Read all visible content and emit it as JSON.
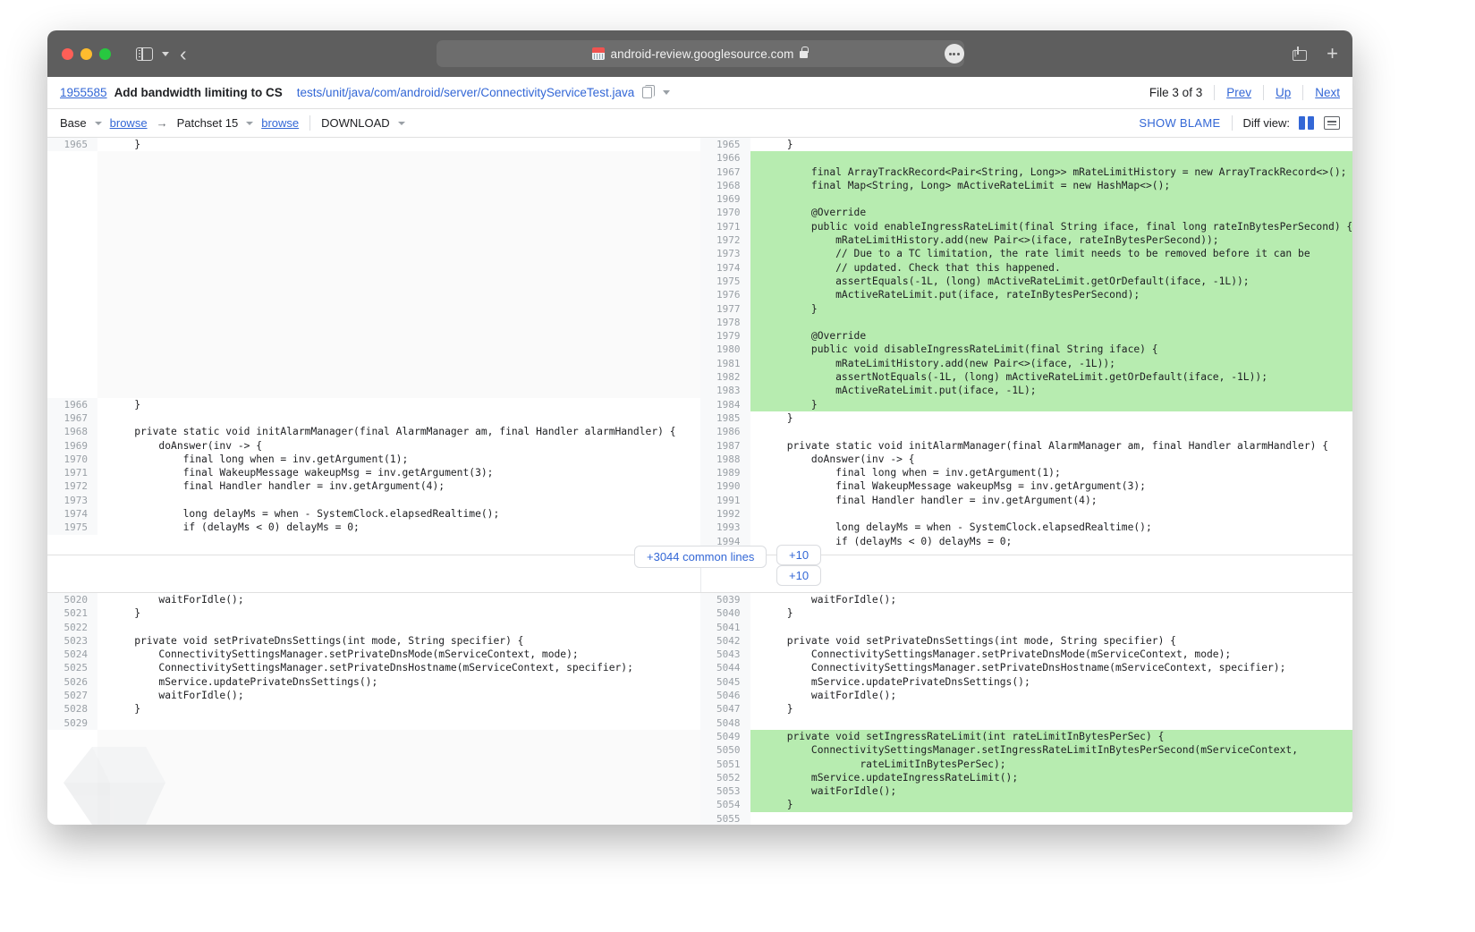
{
  "browser": {
    "url": "android-review.googlesource.com",
    "favicon_name": "gerrit-favicon",
    "lock_name": "lock-icon",
    "sidebar_toggle_name": "sidebar-toggle-icon",
    "back_name": "back-button",
    "share_name": "share-icon",
    "new_tab_name": "new-tab-button",
    "page_menu_name": "page-menu-button"
  },
  "header": {
    "change_number": "1955585",
    "subject": "Add bandwidth limiting to CS",
    "file_path": "tests/unit/java/com/android/server/ConnectivityServiceTest.java",
    "file_count": "File 3 of 3",
    "prev": "Prev",
    "up": "Up",
    "next": "Next"
  },
  "subheader": {
    "base": "Base",
    "browse_left": "browse",
    "arrow": "→",
    "patchset": "Patchset 15",
    "browse_right": "browse",
    "download": "DOWNLOAD",
    "show_blame": "SHOW BLAME",
    "diff_view_label": "Diff view:",
    "diff_view_side_by_side": "side-by-side",
    "diff_view_unified": "unified"
  },
  "widgets": {
    "common_lines": "+3044 common lines",
    "expand_up": "+10",
    "expand_down": "+10"
  },
  "colors": {
    "added_bg": "#b7ecb0",
    "link": "#3367d6",
    "line_number": "#9aa0a6",
    "chrome": "#5e5e5e"
  },
  "diff": {
    "top": {
      "left": [
        {
          "n": "1965",
          "t": "    }",
          "add": false,
          "partial": true
        },
        {
          "n": "",
          "t": "",
          "add": false,
          "fill": true
        },
        {
          "n": "",
          "t": "",
          "add": false,
          "fill": true
        },
        {
          "n": "",
          "t": "",
          "add": false,
          "fill": true
        },
        {
          "n": "",
          "t": "",
          "add": false,
          "fill": true
        },
        {
          "n": "",
          "t": "",
          "add": false,
          "fill": true
        },
        {
          "n": "",
          "t": "",
          "add": false,
          "fill": true
        },
        {
          "n": "",
          "t": "",
          "add": false,
          "fill": true
        },
        {
          "n": "",
          "t": "",
          "add": false,
          "fill": true
        },
        {
          "n": "",
          "t": "",
          "add": false,
          "fill": true
        },
        {
          "n": "",
          "t": "",
          "add": false,
          "fill": true
        },
        {
          "n": "",
          "t": "",
          "add": false,
          "fill": true
        },
        {
          "n": "",
          "t": "",
          "add": false,
          "fill": true
        },
        {
          "n": "",
          "t": "",
          "add": false,
          "fill": true
        },
        {
          "n": "",
          "t": "",
          "add": false,
          "fill": true
        },
        {
          "n": "",
          "t": "",
          "add": false,
          "fill": true
        },
        {
          "n": "",
          "t": "",
          "add": false,
          "fill": true
        },
        {
          "n": "",
          "t": "",
          "add": false,
          "fill": true
        },
        {
          "n": "",
          "t": "",
          "add": false,
          "fill": true
        },
        {
          "n": "1966",
          "t": "    }",
          "add": false
        },
        {
          "n": "1967",
          "t": "",
          "add": false
        },
        {
          "n": "1968",
          "t": "    private static void initAlarmManager(final AlarmManager am, final Handler alarmHandler) {",
          "add": false
        },
        {
          "n": "1969",
          "t": "        doAnswer(inv -> {",
          "add": false
        },
        {
          "n": "1970",
          "t": "            final long when = inv.getArgument(1);",
          "add": false
        },
        {
          "n": "1971",
          "t": "            final WakeupMessage wakeupMsg = inv.getArgument(3);",
          "add": false
        },
        {
          "n": "1972",
          "t": "            final Handler handler = inv.getArgument(4);",
          "add": false
        },
        {
          "n": "1973",
          "t": "",
          "add": false
        },
        {
          "n": "1974",
          "t": "            long delayMs = when - SystemClock.elapsedRealtime();",
          "add": false
        },
        {
          "n": "1975",
          "t": "            if (delayMs < 0) delayMs = 0;",
          "add": false
        }
      ],
      "right": [
        {
          "n": "1965",
          "t": "    }",
          "add": false,
          "partial": true
        },
        {
          "n": "1966",
          "t": "",
          "add": true
        },
        {
          "n": "1967",
          "t": "        final ArrayTrackRecord<Pair<String, Long>> mRateLimitHistory = new ArrayTrackRecord<>();",
          "add": true
        },
        {
          "n": "1968",
          "t": "        final Map<String, Long> mActiveRateLimit = new HashMap<>();",
          "add": true
        },
        {
          "n": "1969",
          "t": "",
          "add": true
        },
        {
          "n": "1970",
          "t": "        @Override",
          "add": true
        },
        {
          "n": "1971",
          "t": "        public void enableIngressRateLimit(final String iface, final long rateInBytesPerSecond) {",
          "add": true
        },
        {
          "n": "1972",
          "t": "            mRateLimitHistory.add(new Pair<>(iface, rateInBytesPerSecond));",
          "add": true
        },
        {
          "n": "1973",
          "t": "            // Due to a TC limitation, the rate limit needs to be removed before it can be",
          "add": true
        },
        {
          "n": "1974",
          "t": "            // updated. Check that this happened.",
          "add": true
        },
        {
          "n": "1975",
          "t": "            assertEquals(-1L, (long) mActiveRateLimit.getOrDefault(iface, -1L));",
          "add": true
        },
        {
          "n": "1976",
          "t": "            mActiveRateLimit.put(iface, rateInBytesPerSecond);",
          "add": true
        },
        {
          "n": "1977",
          "t": "        }",
          "add": true
        },
        {
          "n": "1978",
          "t": "",
          "add": true
        },
        {
          "n": "1979",
          "t": "        @Override",
          "add": true
        },
        {
          "n": "1980",
          "t": "        public void disableIngressRateLimit(final String iface) {",
          "add": true
        },
        {
          "n": "1981",
          "t": "            mRateLimitHistory.add(new Pair<>(iface, -1L));",
          "add": true
        },
        {
          "n": "1982",
          "t": "            assertNotEquals(-1L, (long) mActiveRateLimit.getOrDefault(iface, -1L));",
          "add": true
        },
        {
          "n": "1983",
          "t": "            mActiveRateLimit.put(iface, -1L);",
          "add": true
        },
        {
          "n": "1984",
          "t": "        }",
          "add": true
        },
        {
          "n": "1985",
          "t": "    }",
          "add": false
        },
        {
          "n": "1986",
          "t": "",
          "add": false
        },
        {
          "n": "1987",
          "t": "    private static void initAlarmManager(final AlarmManager am, final Handler alarmHandler) {",
          "add": false
        },
        {
          "n": "1988",
          "t": "        doAnswer(inv -> {",
          "add": false
        },
        {
          "n": "1989",
          "t": "            final long when = inv.getArgument(1);",
          "add": false
        },
        {
          "n": "1990",
          "t": "            final WakeupMessage wakeupMsg = inv.getArgument(3);",
          "add": false
        },
        {
          "n": "1991",
          "t": "            final Handler handler = inv.getArgument(4);",
          "add": false
        },
        {
          "n": "1992",
          "t": "",
          "add": false
        },
        {
          "n": "1993",
          "t": "            long delayMs = when - SystemClock.elapsedRealtime();",
          "add": false
        },
        {
          "n": "1994",
          "t": "            if (delayMs < 0) delayMs = 0;",
          "add": false
        }
      ]
    },
    "bottom": {
      "left": [
        {
          "n": "5020",
          "t": "        waitForIdle();",
          "add": false
        },
        {
          "n": "5021",
          "t": "    }",
          "add": false
        },
        {
          "n": "5022",
          "t": "",
          "add": false
        },
        {
          "n": "5023",
          "t": "    private void setPrivateDnsSettings(int mode, String specifier) {",
          "add": false
        },
        {
          "n": "5024",
          "t": "        ConnectivitySettingsManager.setPrivateDnsMode(mServiceContext, mode);",
          "add": false
        },
        {
          "n": "5025",
          "t": "        ConnectivitySettingsManager.setPrivateDnsHostname(mServiceContext, specifier);",
          "add": false
        },
        {
          "n": "5026",
          "t": "        mService.updatePrivateDnsSettings();",
          "add": false
        },
        {
          "n": "5027",
          "t": "        waitForIdle();",
          "add": false
        },
        {
          "n": "5028",
          "t": "    }",
          "add": false
        },
        {
          "n": "5029",
          "t": "",
          "add": false
        },
        {
          "n": "",
          "t": "",
          "add": false,
          "fill": true
        },
        {
          "n": "",
          "t": "",
          "add": false,
          "fill": true
        },
        {
          "n": "",
          "t": "",
          "add": false,
          "fill": true
        },
        {
          "n": "",
          "t": "",
          "add": false,
          "fill": true
        },
        {
          "n": "",
          "t": "",
          "add": false,
          "fill": true
        },
        {
          "n": "",
          "t": "",
          "add": false,
          "fill": true
        },
        {
          "n": "",
          "t": "",
          "add": false,
          "fill": true
        }
      ],
      "right": [
        {
          "n": "5039",
          "t": "        waitForIdle();",
          "add": false
        },
        {
          "n": "5040",
          "t": "    }",
          "add": false
        },
        {
          "n": "5041",
          "t": "",
          "add": false
        },
        {
          "n": "5042",
          "t": "    private void setPrivateDnsSettings(int mode, String specifier) {",
          "add": false
        },
        {
          "n": "5043",
          "t": "        ConnectivitySettingsManager.setPrivateDnsMode(mServiceContext, mode);",
          "add": false
        },
        {
          "n": "5044",
          "t": "        ConnectivitySettingsManager.setPrivateDnsHostname(mServiceContext, specifier);",
          "add": false
        },
        {
          "n": "5045",
          "t": "        mService.updatePrivateDnsSettings();",
          "add": false
        },
        {
          "n": "5046",
          "t": "        waitForIdle();",
          "add": false
        },
        {
          "n": "5047",
          "t": "    }",
          "add": false
        },
        {
          "n": "5048",
          "t": "",
          "add": false
        },
        {
          "n": "5049",
          "t": "    private void setIngressRateLimit(int rateLimitInBytesPerSec) {",
          "add": true
        },
        {
          "n": "5050",
          "t": "        ConnectivitySettingsManager.setIngressRateLimitInBytesPerSecond(mServiceContext,",
          "add": true
        },
        {
          "n": "5051",
          "t": "                rateLimitInBytesPerSec);",
          "add": true
        },
        {
          "n": "5052",
          "t": "        mService.updateIngressRateLimit();",
          "add": true
        },
        {
          "n": "5053",
          "t": "        waitForIdle();",
          "add": true
        },
        {
          "n": "5054",
          "t": "    }",
          "add": true
        },
        {
          "n": "5055",
          "t": "",
          "add": false
        }
      ]
    }
  }
}
